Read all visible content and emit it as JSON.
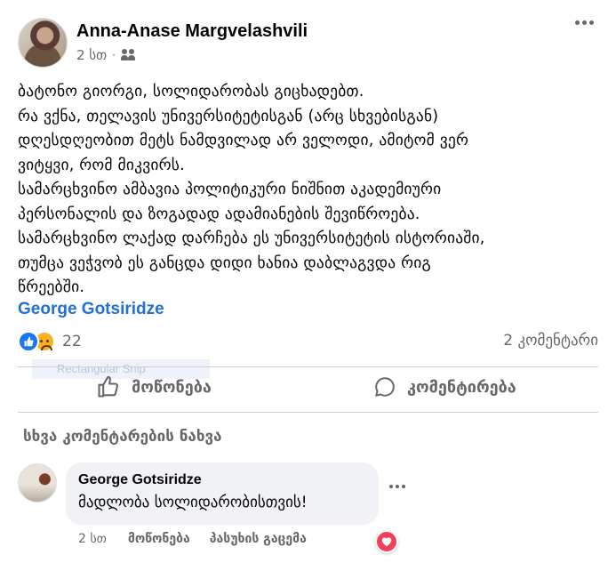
{
  "post": {
    "author": "Anna-Anase Margvelashvili",
    "time": "2 სთ",
    "separator": "·",
    "audience_icon": "friends-icon",
    "lines": [
      "ბატონო გიორგი, სოლიდარობას გიცხადებთ.",
      "რა ვქნა, თელავის უნივერსიტეტისგან (არც სხვებისგან)",
      "დღესდღეობით მეტს ნამდვილად არ ველოდი, ამიტომ ვერ",
      "ვიტყვი, რომ მიკვირს.",
      "სამარცხვინო ამბავია პოლიტიკური ნიშნით აკადემიური",
      "პერსონალის და ზოგადად ადამიანების შევიწროება.",
      "სამარცხვინო ლაქად დარჩება ეს უნივერსიტეტის ისტორიაში,",
      "თუმცა ვეჭვობ ეს განცდა დიდი ხანია დაბლაგვდა რიგ",
      "წრეებში."
    ],
    "mention": "George Gotsiridze"
  },
  "reactions": {
    "icons": [
      "like-icon",
      "sad-icon"
    ],
    "count": "22",
    "comments": "2 კომენტარი"
  },
  "overlay": {
    "snip_label": "Rectangular Snip"
  },
  "actions": {
    "like_label": "მოწონება",
    "comment_label": "კომენტირება"
  },
  "comments_section": {
    "view_more": "სხვა კომენტარების ნახვა",
    "comment": {
      "author": "George Gotsiridze",
      "text": "მადლობა სოლიდარობისთვის!",
      "time": "2 სთ",
      "like": "მოწონება",
      "reply": "პასუხის გაცემა",
      "reaction_icon": "heart-icon"
    }
  },
  "colors": {
    "link_blue": "#216fdb",
    "like_blue": "#1877f2",
    "muted": "#65676b",
    "bubble": "#f0f2f5",
    "love_red": "#f33e58"
  }
}
